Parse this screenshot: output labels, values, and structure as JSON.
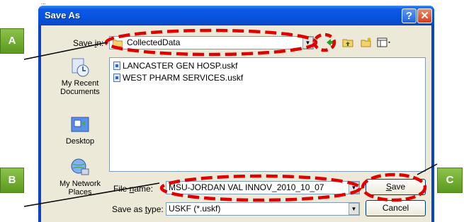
{
  "fragment": "...",
  "window": {
    "title": "Save As",
    "help_label": "?",
    "close_label": "✕"
  },
  "save_in": {
    "label_pre": "Save ",
    "label_key": "i",
    "label_post": "n:",
    "value": "CollectedData"
  },
  "places": [
    {
      "label": "My Recent Documents",
      "icon": "recent-documents-icon"
    },
    {
      "label": "Desktop",
      "icon": "desktop-icon"
    },
    {
      "label": "My Network Places",
      "icon": "network-places-icon"
    }
  ],
  "files": [
    {
      "name": "LANCASTER GEN HOSP.uskf"
    },
    {
      "name": "WEST PHARM SERVICES.uskf"
    }
  ],
  "file_name": {
    "label_pre": "File ",
    "label_key": "n",
    "label_post": "ame:",
    "value": "MSU-JORDAN VAL INNOV_2010_10_07"
  },
  "save_type": {
    "label_pre": "Save as ",
    "label_key": "t",
    "label_post": "ype:",
    "value": "USKF (*.uskf)"
  },
  "buttons": {
    "save_key": "S",
    "save_rest": "ave",
    "cancel": "Cancel"
  },
  "annotations": {
    "a": "A",
    "b": "B",
    "c": "C",
    "color": "#e00000",
    "badge_color": "#6aa628"
  }
}
